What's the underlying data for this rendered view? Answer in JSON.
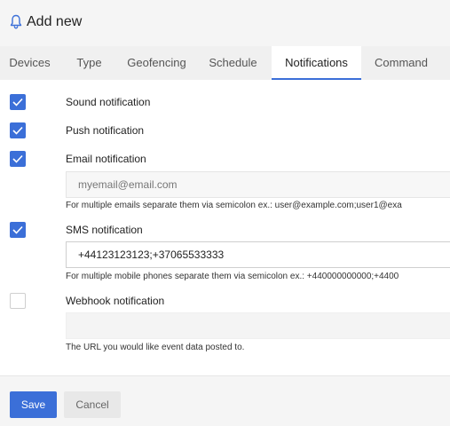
{
  "header": {
    "title": "Add new",
    "icon": "bell-icon"
  },
  "tabs": [
    {
      "label": "Devices"
    },
    {
      "label": "Type"
    },
    {
      "label": "Geofencing"
    },
    {
      "label": "Schedule"
    },
    {
      "label": "Notifications",
      "active": true
    },
    {
      "label": "Command"
    }
  ],
  "notifications": {
    "sound": {
      "label": "Sound notification",
      "checked": true
    },
    "push": {
      "label": "Push notification",
      "checked": true
    },
    "email": {
      "label": "Email notification",
      "checked": true,
      "value": "",
      "placeholder": "myemail@email.com",
      "help": "For multiple emails separate them via semicolon ex.: user@example.com;user1@exa"
    },
    "sms": {
      "label": "SMS notification",
      "checked": true,
      "value": "+44123123123;+37065533333",
      "help": "For multiple mobile phones separate them via semicolon ex.: +440000000000;+4400"
    },
    "webhook": {
      "label": "Webhook notification",
      "checked": false,
      "value": "",
      "help": "The URL you would like event data posted to."
    }
  },
  "footer": {
    "save_label": "Save",
    "cancel_label": "Cancel"
  },
  "colors": {
    "accent": "#3b6fd8"
  }
}
